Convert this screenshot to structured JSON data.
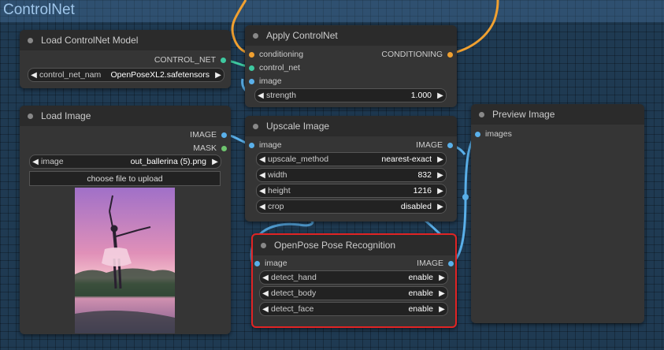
{
  "group": {
    "title": "ControlNet"
  },
  "colors": {
    "conditioning": "#f0a030",
    "control_net": "#3ec9a0",
    "image": "#5ab0ea",
    "mask": "#6ec46e",
    "selection": "#e02424"
  },
  "nodes": {
    "load_controlnet": {
      "title": "Load ControlNet Model",
      "output_control_net": "CONTROL_NET",
      "widget_label": "control_net_nam",
      "widget_value": "OpenPoseXL2.safetensors"
    },
    "apply_controlnet": {
      "title": "Apply ControlNet",
      "input_conditioning": "conditioning",
      "input_control_net": "control_net",
      "input_image": "image",
      "output_conditioning": "CONDITIONING",
      "strength_label": "strength",
      "strength_value": "1.000"
    },
    "load_image": {
      "title": "Load Image",
      "output_image": "IMAGE",
      "output_mask": "MASK",
      "image_label": "image",
      "image_value": "out_ballerina (5).png",
      "upload_label": "choose file to upload"
    },
    "upscale_image": {
      "title": "Upscale Image",
      "input_image": "image",
      "output_image": "IMAGE",
      "method_label": "upscale_method",
      "method_value": "nearest-exact",
      "width_label": "width",
      "width_value": "832",
      "height_label": "height",
      "height_value": "1216",
      "crop_label": "crop",
      "crop_value": "disabled"
    },
    "preview_image": {
      "title": "Preview Image",
      "input_images": "images"
    },
    "openpose": {
      "title": "OpenPose Pose Recognition",
      "input_image": "image",
      "output_image": "IMAGE",
      "hand_label": "detect_hand",
      "hand_value": "enable",
      "body_label": "detect_body",
      "body_value": "enable",
      "face_label": "detect_face",
      "face_value": "enable"
    }
  }
}
